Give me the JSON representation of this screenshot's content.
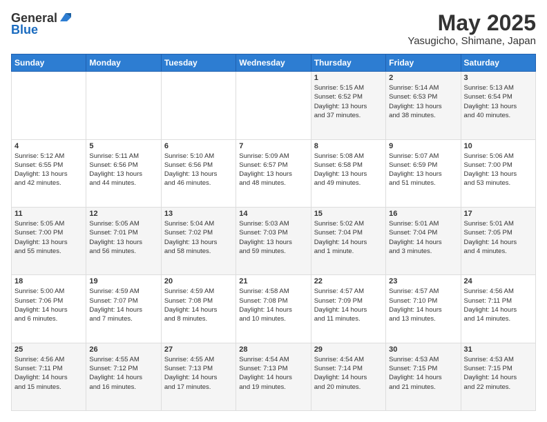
{
  "header": {
    "logo_general": "General",
    "logo_blue": "Blue",
    "month_title": "May 2025",
    "location": "Yasugicho, Shimane, Japan"
  },
  "days_of_week": [
    "Sunday",
    "Monday",
    "Tuesday",
    "Wednesday",
    "Thursday",
    "Friday",
    "Saturday"
  ],
  "weeks": [
    {
      "row_class": "row-1",
      "days": [
        {
          "number": "",
          "info": ""
        },
        {
          "number": "",
          "info": ""
        },
        {
          "number": "",
          "info": ""
        },
        {
          "number": "",
          "info": ""
        },
        {
          "number": "1",
          "info": "Sunrise: 5:15 AM\nSunset: 6:52 PM\nDaylight: 13 hours\nand 37 minutes."
        },
        {
          "number": "2",
          "info": "Sunrise: 5:14 AM\nSunset: 6:53 PM\nDaylight: 13 hours\nand 38 minutes."
        },
        {
          "number": "3",
          "info": "Sunrise: 5:13 AM\nSunset: 6:54 PM\nDaylight: 13 hours\nand 40 minutes."
        }
      ]
    },
    {
      "row_class": "row-2",
      "days": [
        {
          "number": "4",
          "info": "Sunrise: 5:12 AM\nSunset: 6:55 PM\nDaylight: 13 hours\nand 42 minutes."
        },
        {
          "number": "5",
          "info": "Sunrise: 5:11 AM\nSunset: 6:56 PM\nDaylight: 13 hours\nand 44 minutes."
        },
        {
          "number": "6",
          "info": "Sunrise: 5:10 AM\nSunset: 6:56 PM\nDaylight: 13 hours\nand 46 minutes."
        },
        {
          "number": "7",
          "info": "Sunrise: 5:09 AM\nSunset: 6:57 PM\nDaylight: 13 hours\nand 48 minutes."
        },
        {
          "number": "8",
          "info": "Sunrise: 5:08 AM\nSunset: 6:58 PM\nDaylight: 13 hours\nand 49 minutes."
        },
        {
          "number": "9",
          "info": "Sunrise: 5:07 AM\nSunset: 6:59 PM\nDaylight: 13 hours\nand 51 minutes."
        },
        {
          "number": "10",
          "info": "Sunrise: 5:06 AM\nSunset: 7:00 PM\nDaylight: 13 hours\nand 53 minutes."
        }
      ]
    },
    {
      "row_class": "row-3",
      "days": [
        {
          "number": "11",
          "info": "Sunrise: 5:05 AM\nSunset: 7:00 PM\nDaylight: 13 hours\nand 55 minutes."
        },
        {
          "number": "12",
          "info": "Sunrise: 5:05 AM\nSunset: 7:01 PM\nDaylight: 13 hours\nand 56 minutes."
        },
        {
          "number": "13",
          "info": "Sunrise: 5:04 AM\nSunset: 7:02 PM\nDaylight: 13 hours\nand 58 minutes."
        },
        {
          "number": "14",
          "info": "Sunrise: 5:03 AM\nSunset: 7:03 PM\nDaylight: 13 hours\nand 59 minutes."
        },
        {
          "number": "15",
          "info": "Sunrise: 5:02 AM\nSunset: 7:04 PM\nDaylight: 14 hours\nand 1 minute."
        },
        {
          "number": "16",
          "info": "Sunrise: 5:01 AM\nSunset: 7:04 PM\nDaylight: 14 hours\nand 3 minutes."
        },
        {
          "number": "17",
          "info": "Sunrise: 5:01 AM\nSunset: 7:05 PM\nDaylight: 14 hours\nand 4 minutes."
        }
      ]
    },
    {
      "row_class": "row-4",
      "days": [
        {
          "number": "18",
          "info": "Sunrise: 5:00 AM\nSunset: 7:06 PM\nDaylight: 14 hours\nand 6 minutes."
        },
        {
          "number": "19",
          "info": "Sunrise: 4:59 AM\nSunset: 7:07 PM\nDaylight: 14 hours\nand 7 minutes."
        },
        {
          "number": "20",
          "info": "Sunrise: 4:59 AM\nSunset: 7:08 PM\nDaylight: 14 hours\nand 8 minutes."
        },
        {
          "number": "21",
          "info": "Sunrise: 4:58 AM\nSunset: 7:08 PM\nDaylight: 14 hours\nand 10 minutes."
        },
        {
          "number": "22",
          "info": "Sunrise: 4:57 AM\nSunset: 7:09 PM\nDaylight: 14 hours\nand 11 minutes."
        },
        {
          "number": "23",
          "info": "Sunrise: 4:57 AM\nSunset: 7:10 PM\nDaylight: 14 hours\nand 13 minutes."
        },
        {
          "number": "24",
          "info": "Sunrise: 4:56 AM\nSunset: 7:11 PM\nDaylight: 14 hours\nand 14 minutes."
        }
      ]
    },
    {
      "row_class": "row-5",
      "days": [
        {
          "number": "25",
          "info": "Sunrise: 4:56 AM\nSunset: 7:11 PM\nDaylight: 14 hours\nand 15 minutes."
        },
        {
          "number": "26",
          "info": "Sunrise: 4:55 AM\nSunset: 7:12 PM\nDaylight: 14 hours\nand 16 minutes."
        },
        {
          "number": "27",
          "info": "Sunrise: 4:55 AM\nSunset: 7:13 PM\nDaylight: 14 hours\nand 17 minutes."
        },
        {
          "number": "28",
          "info": "Sunrise: 4:54 AM\nSunset: 7:13 PM\nDaylight: 14 hours\nand 19 minutes."
        },
        {
          "number": "29",
          "info": "Sunrise: 4:54 AM\nSunset: 7:14 PM\nDaylight: 14 hours\nand 20 minutes."
        },
        {
          "number": "30",
          "info": "Sunrise: 4:53 AM\nSunset: 7:15 PM\nDaylight: 14 hours\nand 21 minutes."
        },
        {
          "number": "31",
          "info": "Sunrise: 4:53 AM\nSunset: 7:15 PM\nDaylight: 14 hours\nand 22 minutes."
        }
      ]
    }
  ]
}
